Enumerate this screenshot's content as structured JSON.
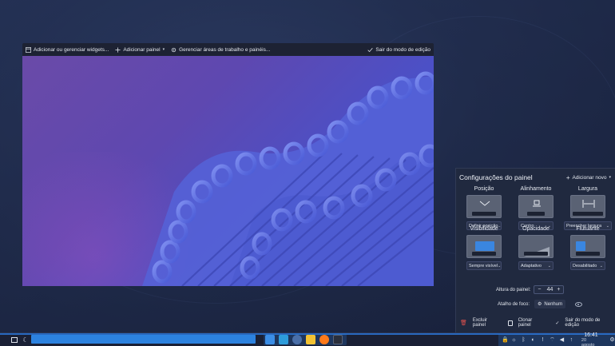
{
  "toolbar": {
    "add_widgets": "Adicionar ou gerenciar widgets...",
    "add_panel": "Adicionar painel",
    "manage_desktops": "Gerenciar áreas de trabalho e painéis...",
    "exit_edit": "Sair do modo de edição"
  },
  "panel_settings": {
    "title": "Configurações do painel",
    "add_new": "Adicionar novo",
    "position": {
      "label": "Posição",
      "value": "Definir posição..."
    },
    "alignment": {
      "label": "Alinhamento",
      "value": "Centro"
    },
    "width": {
      "label": "Largura",
      "value": "Preencher largura"
    },
    "visibility": {
      "label": "Visibilidade",
      "value": "Sempre visível"
    },
    "opacity": {
      "label": "Opacidade",
      "value": "Adaptativo"
    },
    "floating": {
      "label": "Flutuante",
      "value": "Desabilitado"
    },
    "height_label": "Altura do painel:",
    "height_value": "44",
    "focus_shortcut_label": "Atalho de foco:",
    "focus_shortcut_value": "Nenhum",
    "delete_panel": "Excluir painel",
    "clone_panel": "Clonar painel",
    "exit_edit": "Sair do modo de edição"
  },
  "taskbar": {
    "time": "16:41",
    "date": "20 agosto"
  },
  "colors": {
    "accent": "#2c82df",
    "panel_bg": "#20293f",
    "taskbar_bg": "#1a2035"
  }
}
